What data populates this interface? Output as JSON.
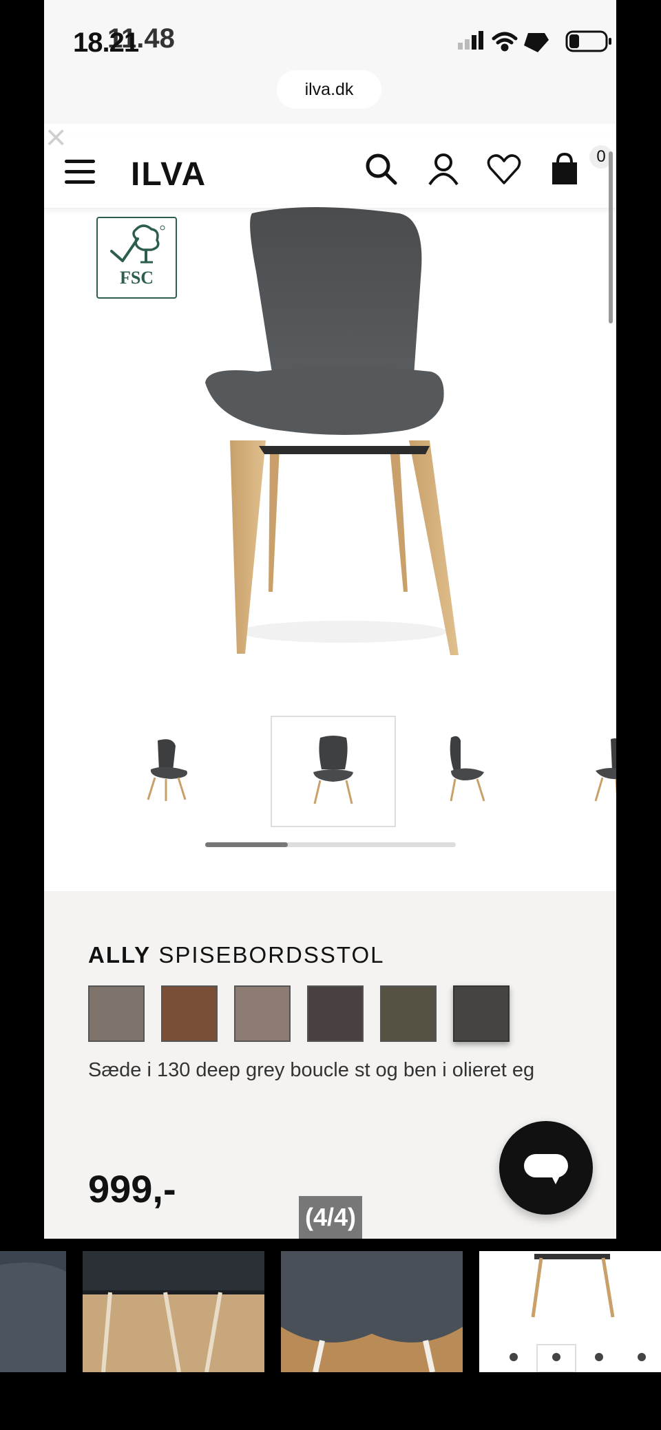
{
  "status": {
    "time": "18.21",
    "time_overlay": "11.48"
  },
  "browser": {
    "url": "ilva.dk"
  },
  "header": {
    "logo": "ILVA",
    "cart_count": "0"
  },
  "badge": {
    "label": "FSC"
  },
  "gallery": {
    "thumb_count": 4,
    "selected_index": 1,
    "progress_fraction": 0.33
  },
  "product": {
    "brand": "ALLY",
    "name": "SPISEBORDSSTOL",
    "swatches": [
      "#7e746b",
      "#7a4f38",
      "#8d7c73",
      "#48413f",
      "#555243",
      "#454440"
    ],
    "description": "Sæde i 130 deep grey boucle st og ben i olieret eg",
    "price": "999,-"
  },
  "viewer": {
    "counter": "(4/4)"
  },
  "colors": {
    "accent": "#111111",
    "fsc_green": "#2c5e4f"
  }
}
